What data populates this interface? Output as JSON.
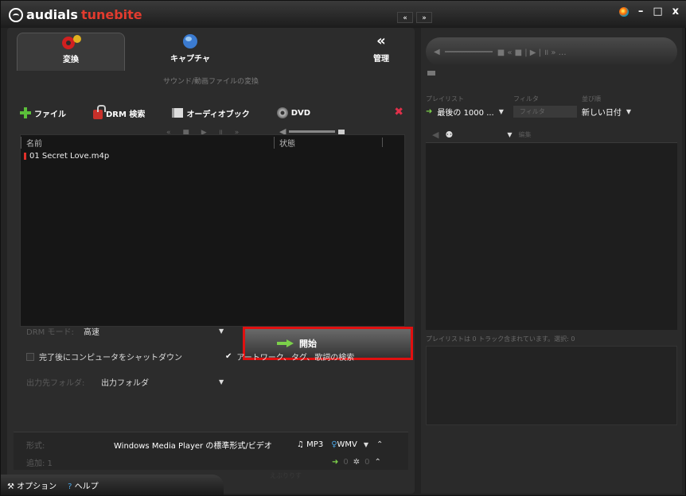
{
  "app": {
    "brand_left": "audials",
    "brand_right": "tunebite"
  },
  "tabs": [
    {
      "label": "変換",
      "icon": "gear-convert-icon"
    },
    {
      "label": "キャプチャ",
      "icon": "globe-icon"
    },
    {
      "label": "管理",
      "icon": "chevron-double-left-icon"
    }
  ],
  "subtitle": "サウンド/動画ファイルの変換",
  "toolbar": {
    "file": "ファイル",
    "drm_search": "DRM 検索",
    "audiobook": "オーディオブック",
    "dvd": "DVD"
  },
  "list": {
    "col_name": "名前",
    "col_status": "状態",
    "rows": [
      {
        "name": "01 Secret Love.m4p"
      }
    ]
  },
  "settings": {
    "drm_mode_label": "DRM モード:",
    "drm_mode_value": "高速",
    "start_button": "開始",
    "shutdown_label": "完了後にコンピュータをシャットダウン",
    "artwork_label": "アートワーク、タグ、歌詞の検索",
    "output_folder_label": "出力先フォルダ:",
    "output_folder_value": "出力フォルダ"
  },
  "format": {
    "label": "形式:",
    "value": "Windows Media Player の標準形式/ビデオ",
    "mp3": "MP3",
    "wmv": "WMV",
    "added_label": "追加: 1",
    "counts": [
      "0",
      "0"
    ]
  },
  "watermark": "えぶりりす",
  "bottom": {
    "options": "オプション",
    "help": "ヘルプ"
  },
  "right": {
    "playlist_label": "プレイリスト",
    "filter_label": "フィルタ",
    "sort_label": "並び順",
    "playlist_value": "最後の 1000 ...",
    "filter_placeholder": "フィルタ",
    "sort_value": "新しい日付",
    "status_text": "プレイリストは 0 トラック含まれています。選択: 0",
    "edit_label": "編集"
  },
  "colors": {
    "accent": "#e23b2e",
    "green": "#7cd04a",
    "highlight": "#e01010"
  }
}
